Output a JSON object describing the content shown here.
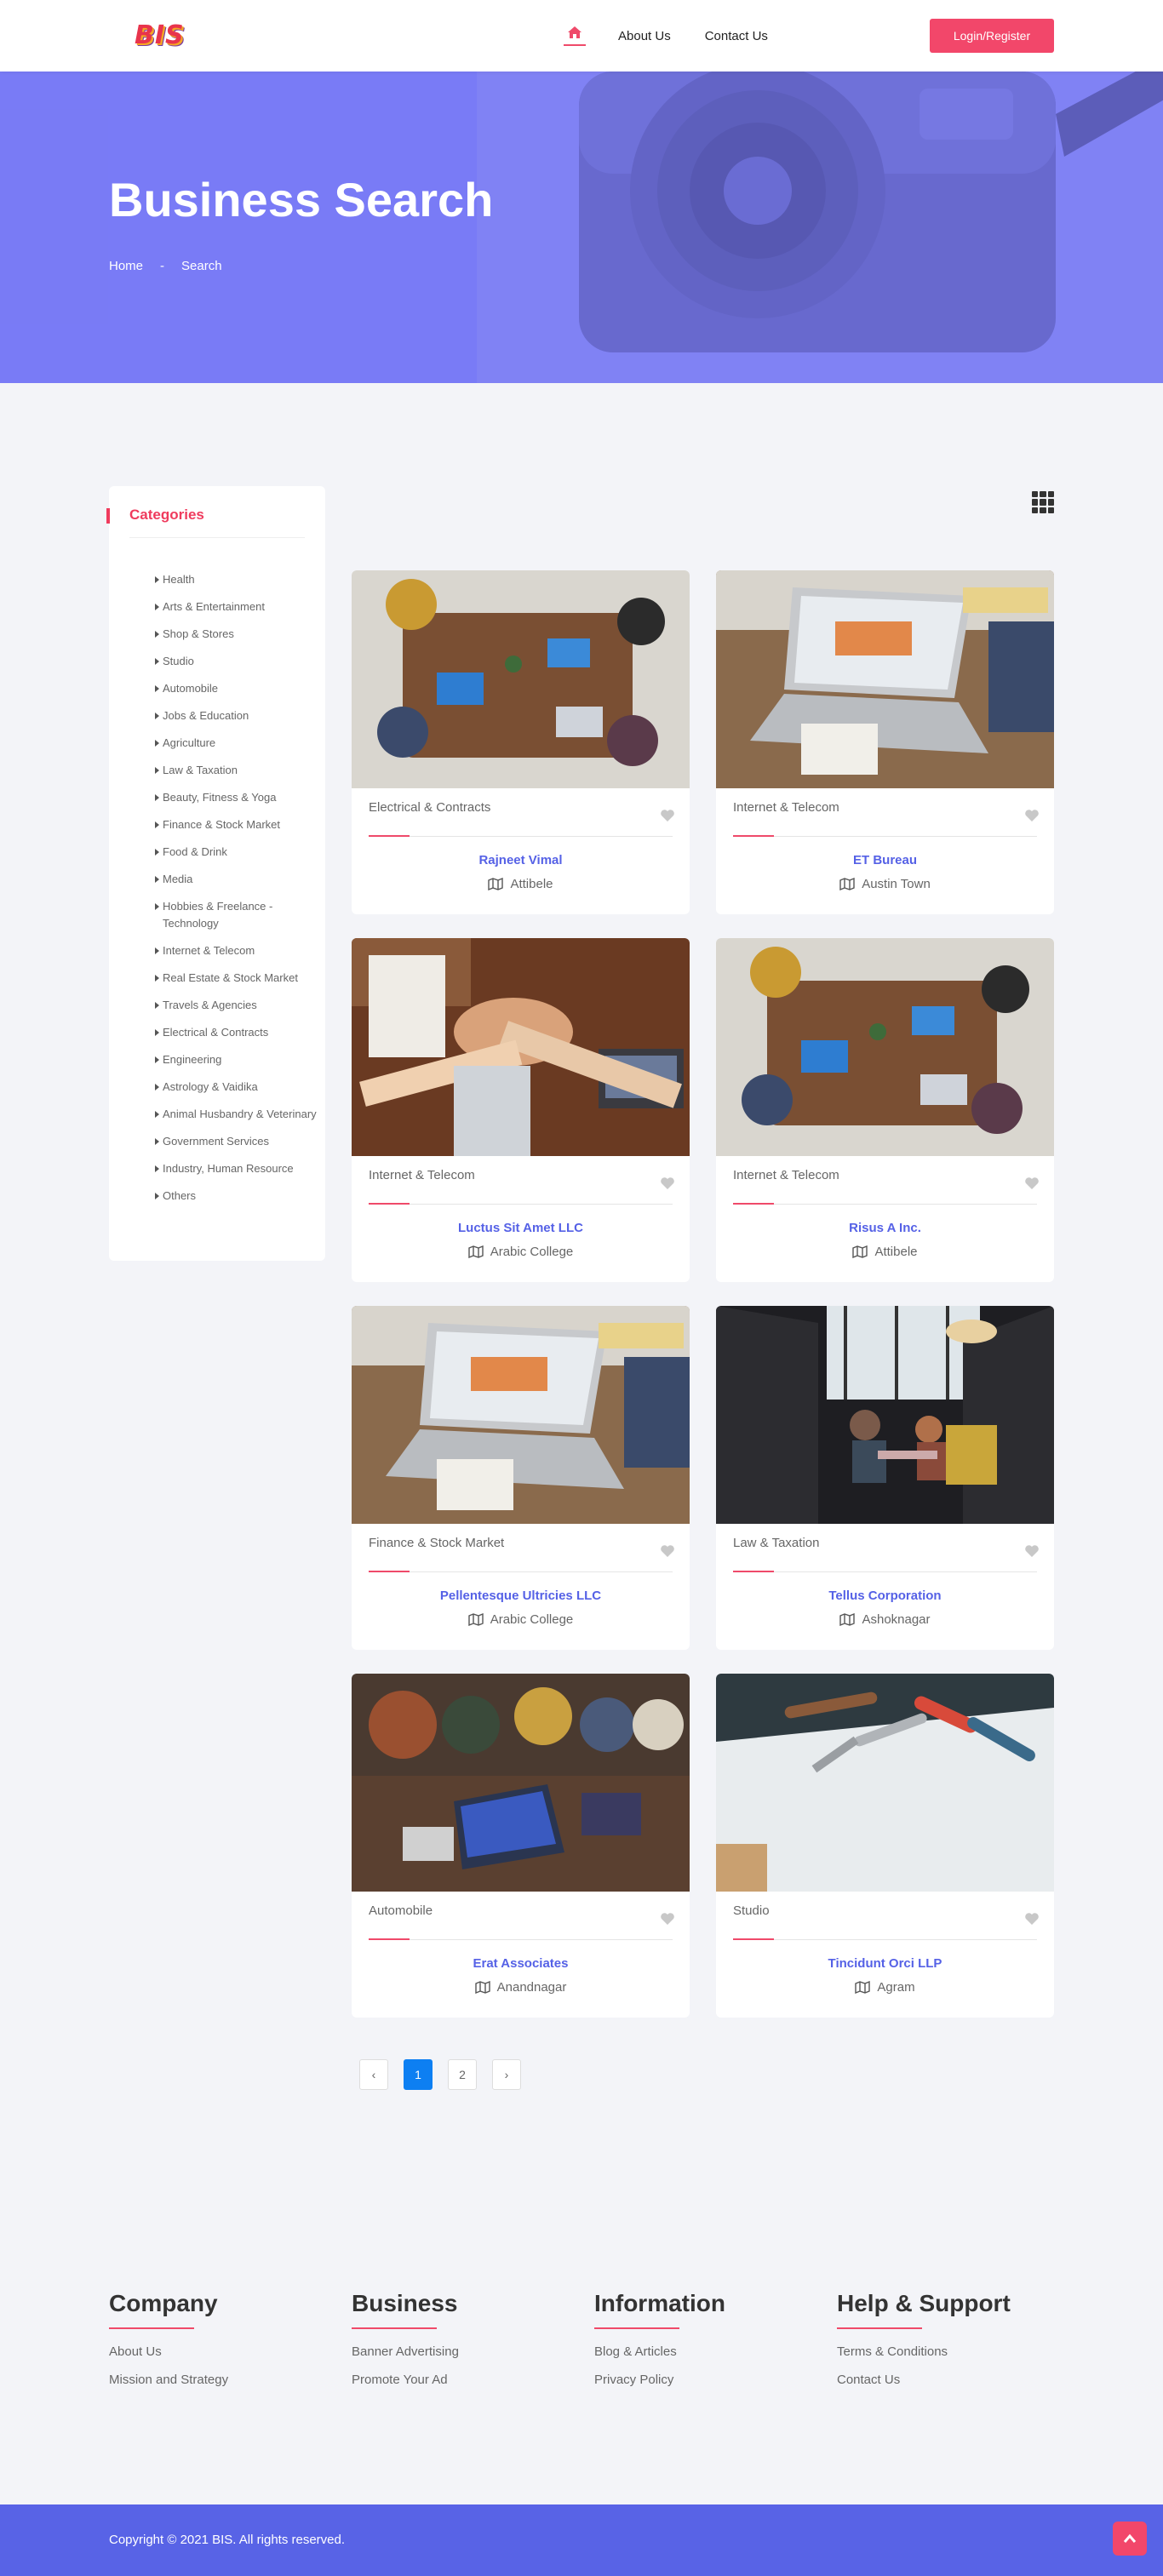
{
  "header": {
    "logo": "BIS",
    "nav": [
      "About Us",
      "Contact Us"
    ],
    "login_label": "Login/Register"
  },
  "hero": {
    "title": "Business Search",
    "breadcrumb": [
      "Home",
      "-",
      "Search"
    ]
  },
  "sidebar": {
    "title": "Categories",
    "items": [
      "Health",
      "Arts & Entertainment",
      "Shop & Stores",
      "Studio",
      "Automobile",
      "Jobs & Education",
      "Agriculture",
      "Law & Taxation",
      "Beauty, Fitness & Yoga",
      "Finance & Stock Market",
      "Food & Drink",
      "Media",
      "Hobbies & Freelance - Technology",
      "Internet & Telecom",
      "Real Estate & Stock Market",
      "Travels & Agencies",
      "Electrical & Contracts",
      "Engineering",
      "Astrology & Vaidika",
      "Animal Husbandry & Veterinary",
      "Government Services",
      "Industry, Human Resource",
      "Others"
    ]
  },
  "listings": [
    {
      "category": "Electrical & Contracts",
      "name": "Rajneet Vimal",
      "location": "Attibele",
      "image": "office-meeting-top-view"
    },
    {
      "category": "Internet & Telecom",
      "name": "ET Bureau",
      "location": "Austin Town",
      "image": "laptop-desk"
    },
    {
      "category": "Internet & Telecom",
      "name": "Luctus Sit Amet LLC",
      "location": "Arabic College",
      "image": "team-hands-stack"
    },
    {
      "category": "Internet & Telecom",
      "name": "Risus A Inc.",
      "location": "Attibele",
      "image": "office-meeting-top-view"
    },
    {
      "category": "Finance & Stock Market",
      "name": "Pellentesque Ultricies LLC",
      "location": "Arabic College",
      "image": "laptop-desk"
    },
    {
      "category": "Law & Taxation",
      "name": "Tellus Corporation",
      "location": "Ashoknagar",
      "image": "office-booth"
    },
    {
      "category": "Automobile",
      "name": "Erat Associates",
      "location": "Anandnagar",
      "image": "team-laptops"
    },
    {
      "category": "Studio",
      "name": "Tincidunt Orci LLP",
      "location": "Agram",
      "image": "tools-on-paper"
    }
  ],
  "pagination": {
    "prev": "‹",
    "pages": [
      "1",
      "2"
    ],
    "next": "›",
    "current": "1"
  },
  "footer": {
    "columns": [
      {
        "title": "Company",
        "links": [
          "About Us",
          "Mission and Strategy"
        ]
      },
      {
        "title": "Business",
        "links": [
          "Banner Advertising",
          "Promote Your Ad"
        ]
      },
      {
        "title": "Information",
        "links": [
          "Blog & Articles",
          "Privacy Policy"
        ]
      },
      {
        "title": "Help & Support",
        "links": [
          "Terms & Conditions",
          "Contact Us"
        ]
      }
    ],
    "copyright": "Copyright © 2021 BIS. All rights reserved."
  },
  "colors": {
    "accent": "#ef4a6a",
    "brand_blue": "#5863e6",
    "hero": "#7b7cf5"
  }
}
